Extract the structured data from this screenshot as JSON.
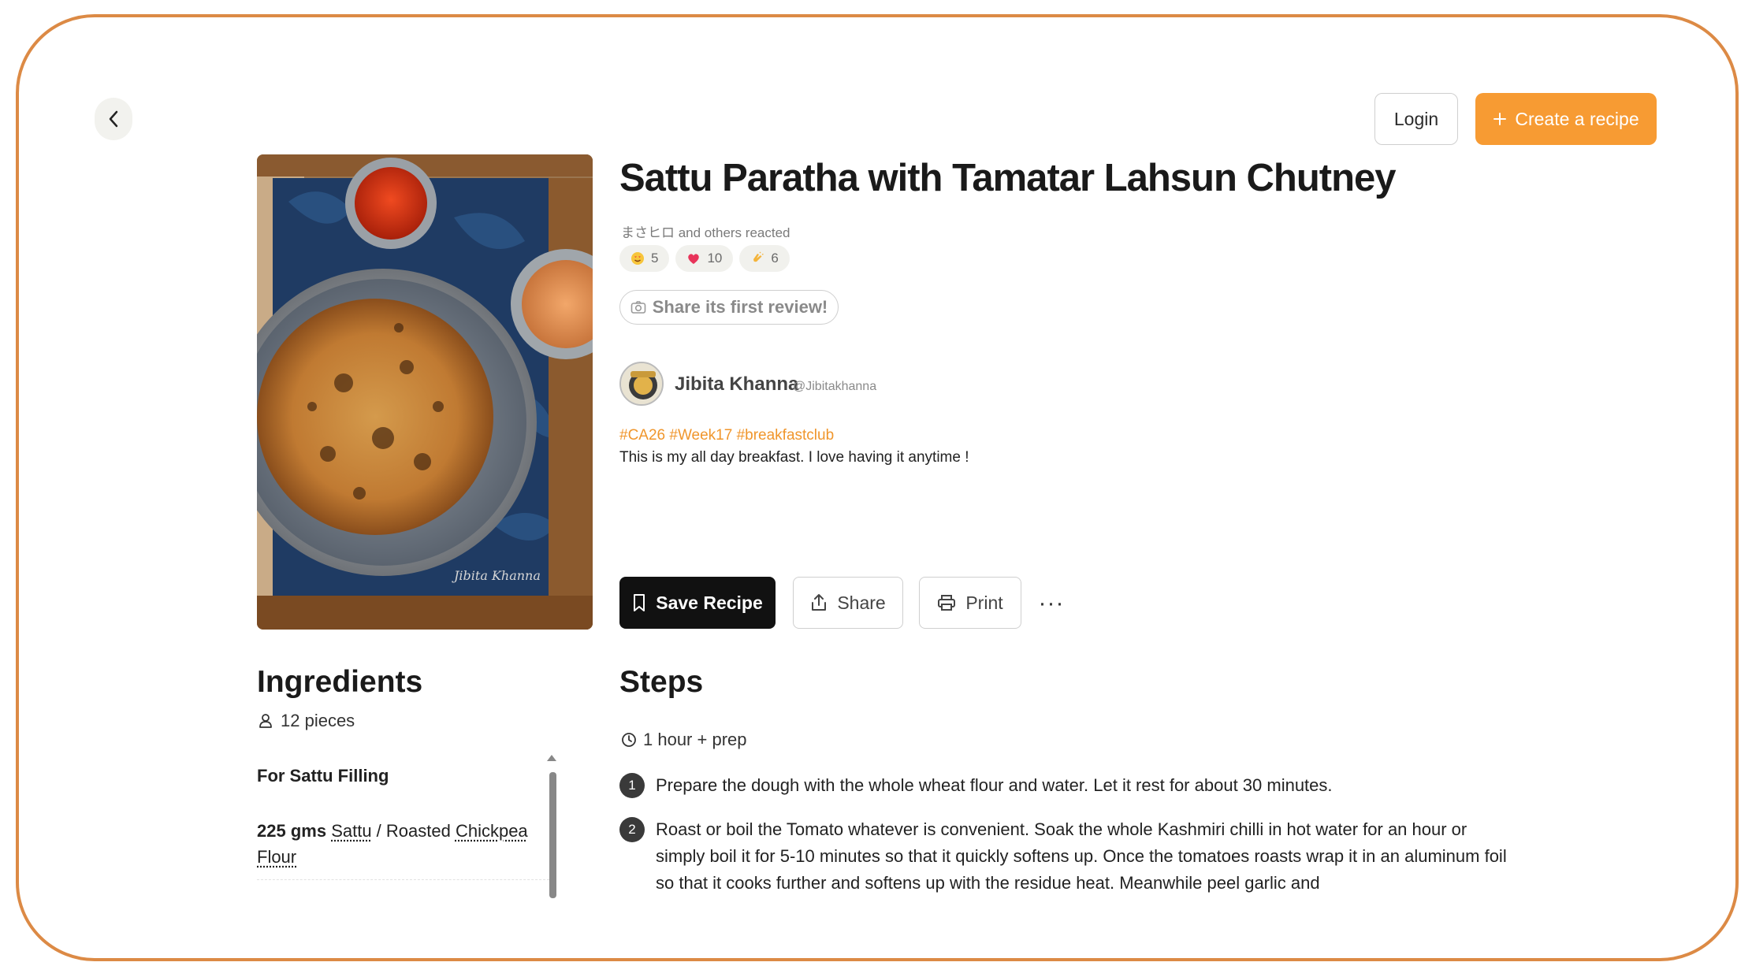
{
  "header": {
    "login_label": "Login",
    "create_label": "Create a recipe"
  },
  "recipe": {
    "title": "Sattu Paratha with Tamatar Lahsun Chutney",
    "reacted_text": "まさヒロ and others reacted",
    "reactions": [
      {
        "icon": "heart-eyes-emoji",
        "count": "5"
      },
      {
        "icon": "heart-emoji",
        "count": "10"
      },
      {
        "icon": "clap-emoji",
        "count": "6"
      }
    ],
    "review_label": "Share its first review!",
    "author": {
      "name": "Jibita Khanna",
      "handle": "@Jibitakhanna"
    },
    "tags": "#CA26 #Week17 #breakfastclub",
    "description": "This is my all day breakfast. I love having it anytime !",
    "photo_watermark": "Jibita Khanna"
  },
  "actions": {
    "save_label": "Save Recipe",
    "share_label": "Share",
    "print_label": "Print",
    "more_label": "···"
  },
  "ingredients": {
    "title": "Ingredients",
    "servings": "12 pieces",
    "section": "For Sattu Filling",
    "item": {
      "quantity": "225 gms",
      "name_1": "Sattu",
      "sep": " / Roasted ",
      "name_2": "Chickpea",
      "name_3": "Flour"
    }
  },
  "steps": {
    "title": "Steps",
    "time": "1 hour + prep",
    "items": [
      {
        "num": "1",
        "text": "Prepare the dough with the whole wheat flour and water. Let it rest for about 30 minutes."
      },
      {
        "num": "2",
        "text": "Roast or boil the Tomato whatever is convenient. Soak the whole Kashmiri chilli in hot water for an hour or simply boil it for 5-10 minutes so that it quickly softens up. Once the tomatoes roasts wrap it in an aluminum foil so that it cooks further and softens up with the residue heat. Meanwhile peel garlic and"
      }
    ]
  },
  "colors": {
    "accent": "#f79b33",
    "tag": "#f0962c",
    "frame": "#dc8a45"
  }
}
